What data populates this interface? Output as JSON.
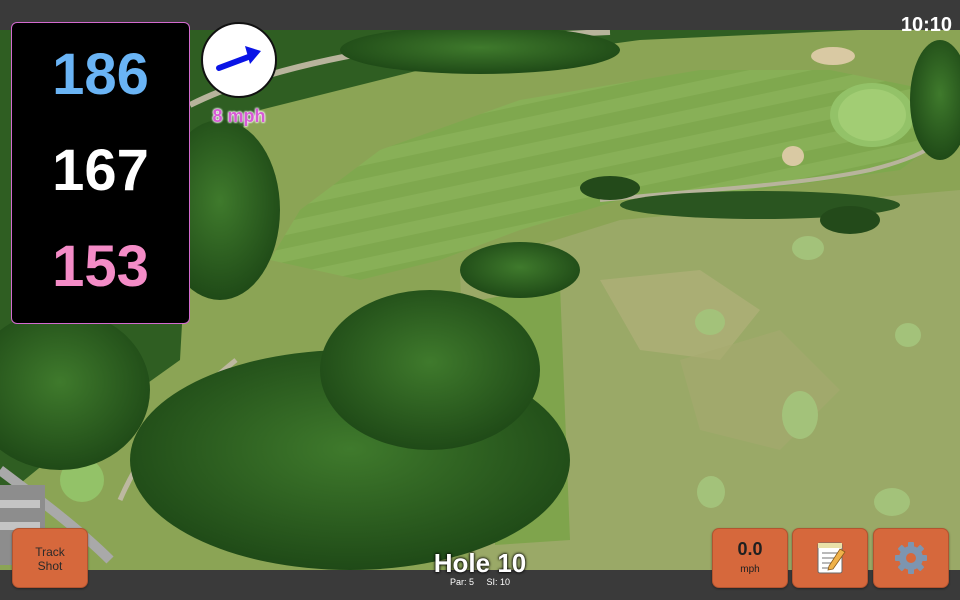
{
  "status_bar": {
    "time": "10:10"
  },
  "yardages": {
    "back": "186",
    "middle": "167",
    "front": "153"
  },
  "wind": {
    "speed_label": "8 mph",
    "direction_icon": "arrow-icon",
    "arrow_color": "#0a14e6"
  },
  "buttons": {
    "track_shot_line1": "Track",
    "track_shot_line2": "Shot",
    "speed_value": "0.0",
    "speed_unit": "mph",
    "notes_icon": "memo-icon",
    "settings_icon": "gear-icon"
  },
  "hole": {
    "title": "Hole 10",
    "par_label": "Par: 5",
    "si_label": "SI: 10"
  },
  "colors": {
    "button_orange": "#d6683c",
    "back_yardage": "#6ab4f5",
    "middle_yardage": "#ffffff",
    "front_yardage": "#f48cc7",
    "panel_border": "#d36ad0"
  }
}
